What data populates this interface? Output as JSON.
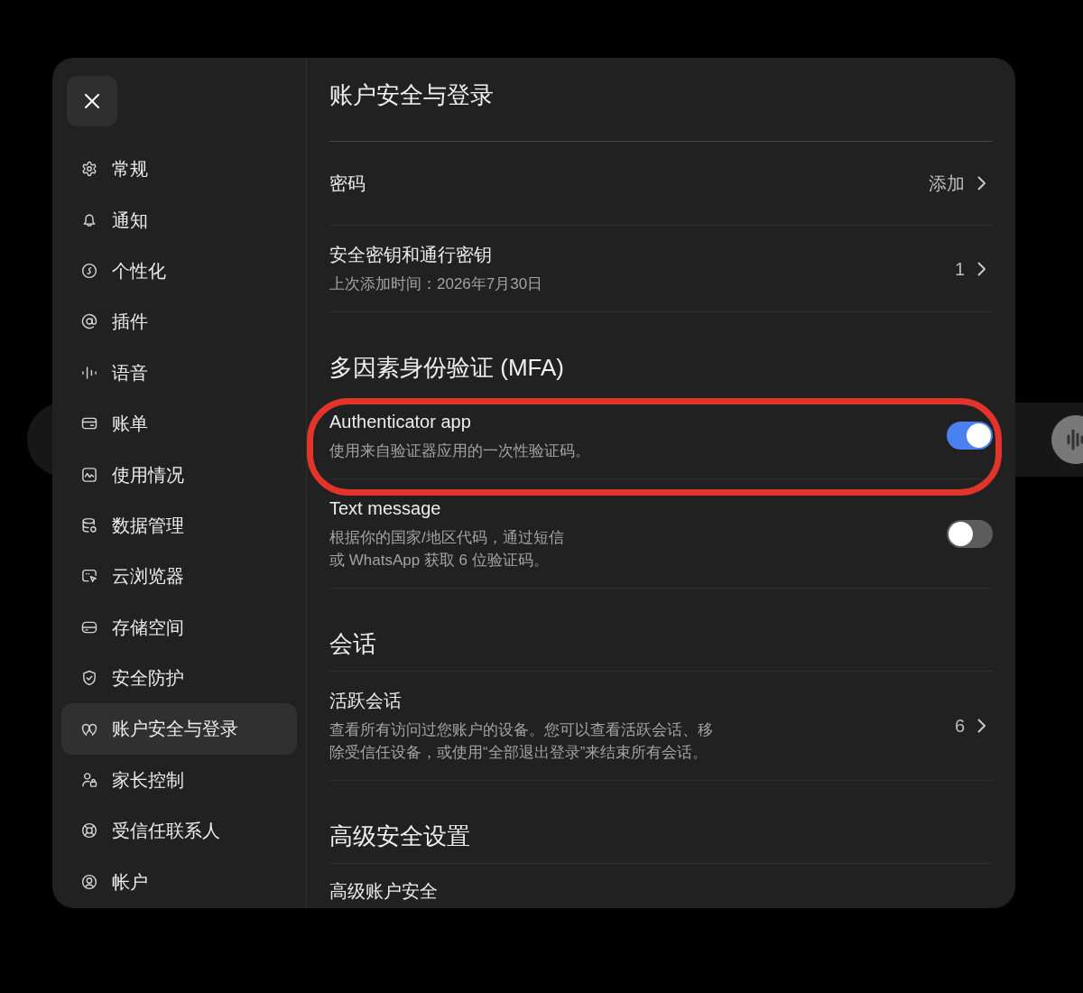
{
  "sidebar": {
    "items": [
      {
        "label": "常规",
        "selected": false
      },
      {
        "label": "通知",
        "selected": false
      },
      {
        "label": "个性化",
        "selected": false
      },
      {
        "label": "插件",
        "selected": false
      },
      {
        "label": "语音",
        "selected": false
      },
      {
        "label": "账单",
        "selected": false
      },
      {
        "label": "使用情况",
        "selected": false
      },
      {
        "label": "数据管理",
        "selected": false
      },
      {
        "label": "云浏览器",
        "selected": false
      },
      {
        "label": "存储空间",
        "selected": false
      },
      {
        "label": "安全防护",
        "selected": false
      },
      {
        "label": "账户安全与登录",
        "selected": true
      },
      {
        "label": "家长控制",
        "selected": false
      },
      {
        "label": "受信任联系人",
        "selected": false
      },
      {
        "label": "帐户",
        "selected": false
      }
    ]
  },
  "page": {
    "title": "账户安全与登录",
    "sections": [
      {
        "rows": [
          {
            "kind": "link",
            "label": "密码",
            "value": "添加"
          },
          {
            "kind": "link",
            "label": "安全密钥和通行密钥",
            "description": "上次添加时间：2026年7月30日",
            "value": "1"
          }
        ]
      },
      {
        "heading": "多因素身份验证 (MFA)",
        "rows": [
          {
            "kind": "toggle",
            "label": "Authenticator app",
            "description": "使用来自验证器应用的一次性验证码。",
            "on": true,
            "highlighted": true
          },
          {
            "kind": "toggle",
            "label": "Text message",
            "description": "根据你的国家/地区代码，通过短信或 WhatsApp 获取 6 位验证码。",
            "on": false,
            "highlighted": false
          }
        ]
      },
      {
        "heading": "会话",
        "rows": [
          {
            "kind": "link",
            "label": "活跃会话",
            "description": "查看所有访问过您账户的设备。您可以查看活跃会话、移除受信任设备，或使用“全部退出登录”来结束所有会话。",
            "value": "6"
          }
        ]
      },
      {
        "heading": "高级安全设置",
        "rows": [
          {
            "kind": "label",
            "label": "高级账户安全"
          }
        ]
      }
    ]
  }
}
